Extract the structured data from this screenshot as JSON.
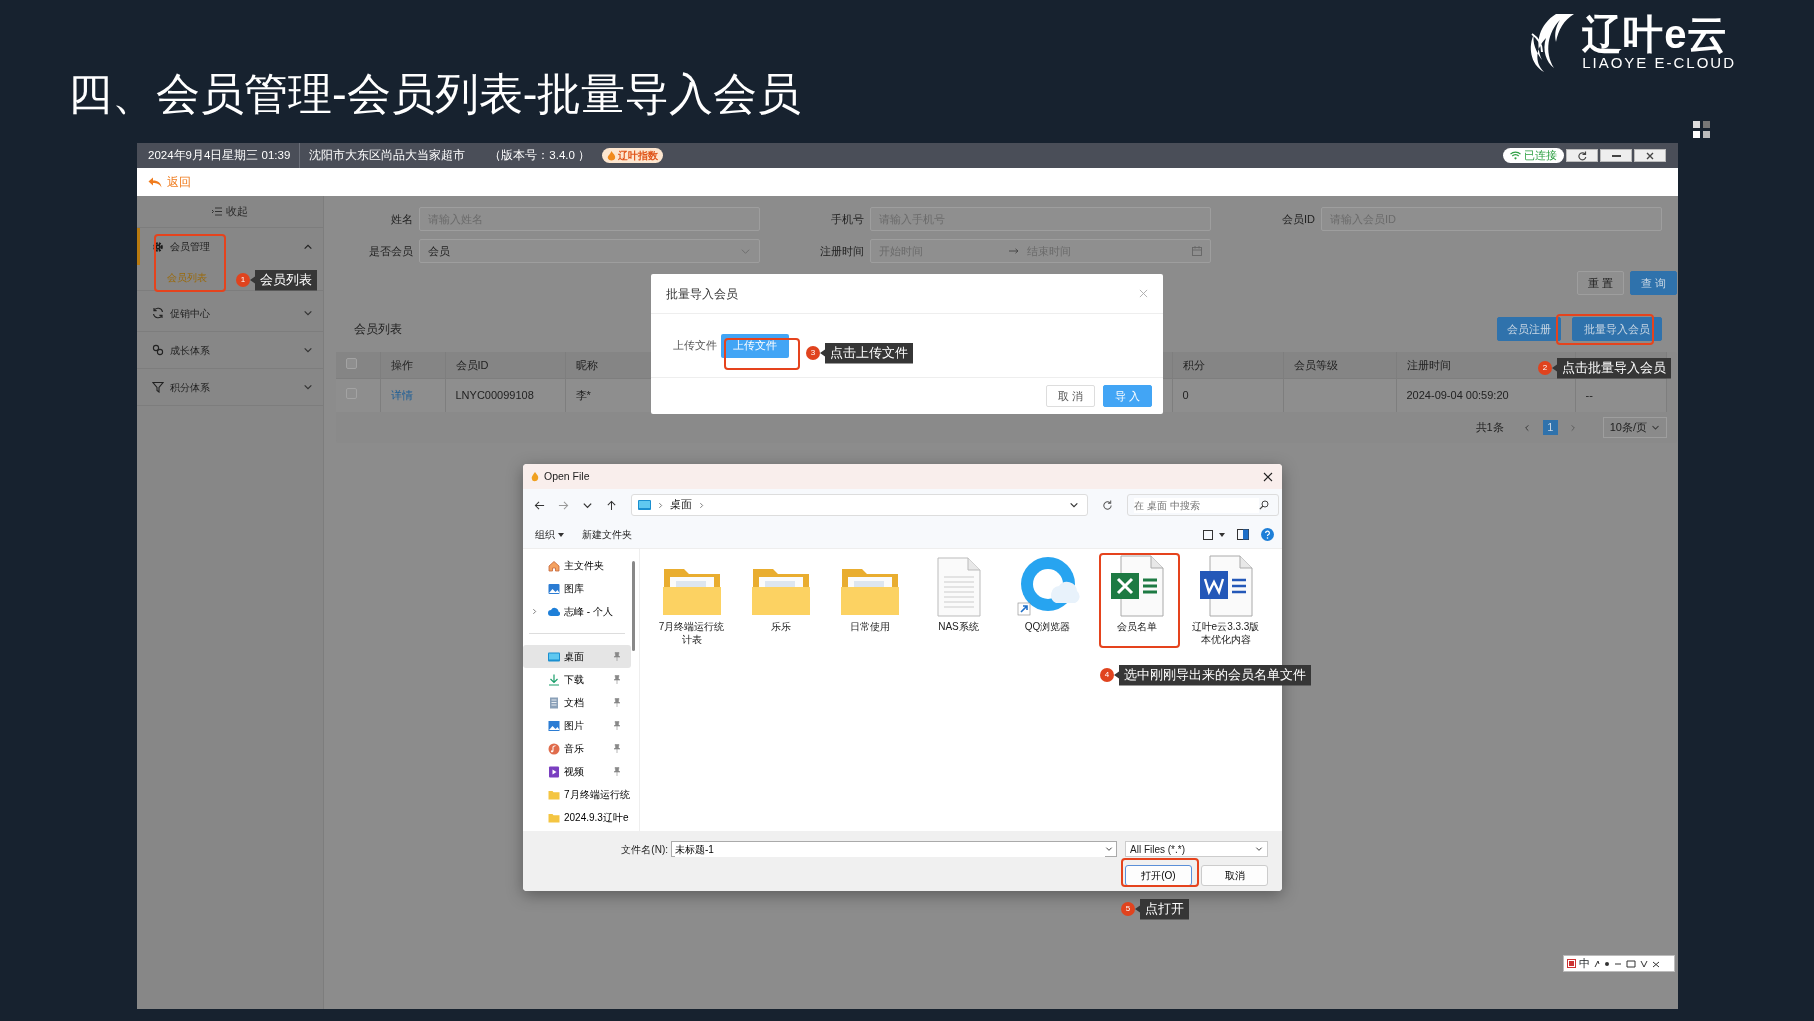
{
  "slide": {
    "title": "四、会员管理-会员列表-批量导入会员",
    "logo_name": "辽叶e云",
    "logo_tagline": "LIAOYE E-CLOUD"
  },
  "app": {
    "top_bar": {
      "datetime": "2024年9月4日星期三 01:39",
      "store": "沈阳市大东区尚品大当家超市",
      "version": "（版本号：3.4.0 ）",
      "badge": "辽叶指数",
      "connection": "已连接"
    },
    "back": "返回",
    "sidebar": {
      "collapse": "收起",
      "items": [
        {
          "label": "会员管理",
          "expanded": true,
          "children": [
            {
              "label": "会员列表",
              "selected": true
            }
          ]
        },
        {
          "label": "促销中心",
          "expanded": false
        },
        {
          "label": "成长体系",
          "expanded": false
        },
        {
          "label": "积分体系",
          "expanded": false
        }
      ]
    },
    "filters": [
      {
        "kind": "text",
        "label": "姓名",
        "placeholder": "请输入姓名"
      },
      {
        "kind": "text",
        "label": "手机号",
        "placeholder": "请输入手机号"
      },
      {
        "kind": "text",
        "label": "会员ID",
        "placeholder": "请输入会员ID"
      },
      {
        "kind": "select",
        "label": "是否会员",
        "value": "会员"
      },
      {
        "kind": "daterange",
        "label": "注册时间",
        "start_placeholder": "开始时间",
        "end_placeholder": "结束时间"
      }
    ],
    "filter_buttons": [
      {
        "label": "重 置",
        "primary": false
      },
      {
        "label": "查 询",
        "primary": true
      }
    ],
    "list_title": "会员列表",
    "list_buttons": [
      "会员注册",
      "批量导入会员"
    ],
    "table": {
      "header_checked": false,
      "columns": [
        "操作",
        "会员ID",
        "昵称",
        "积分",
        "会员等级",
        "注册时间"
      ],
      "rows": [
        {
          "checked": false,
          "action": "详情",
          "member_id": "LNYC00099108",
          "nickname": "李*",
          "points": "0",
          "register_time": "2024-09-04 00:59:20",
          "column_7": "--"
        }
      ]
    },
    "pagination": {
      "total": "共1条",
      "pages": [
        {
          "label": "1",
          "selected": true
        }
      ],
      "page_size": "10条/页"
    },
    "modal": {
      "title": "批量导入会员",
      "field_label": "上传文件",
      "upload_button": "上传文件",
      "buttons": [
        {
          "label": "取 消",
          "primary": false
        },
        {
          "label": "导 入",
          "primary": true
        }
      ]
    },
    "file_dialog": {
      "title": "Open File",
      "path": [
        "桌面"
      ],
      "search_placeholder": "在 桌面 中搜索",
      "toolbar": [
        "组织",
        "新建文件夹"
      ],
      "nav_groups": [
        [
          {
            "label": "主文件夹",
            "expandable": false,
            "pinned": false,
            "selected": false
          },
          {
            "label": "图库",
            "expandable": false,
            "pinned": false,
            "selected": false
          },
          {
            "label": "志峰 - 个人",
            "expandable": true,
            "pinned": false,
            "selected": false
          }
        ],
        [
          {
            "label": "桌面",
            "expandable": false,
            "pinned": true,
            "selected": true
          },
          {
            "label": "下载",
            "expandable": false,
            "pinned": true,
            "selected": false
          },
          {
            "label": "文档",
            "expandable": false,
            "pinned": true,
            "selected": false
          },
          {
            "label": "图片",
            "expandable": false,
            "pinned": true,
            "selected": false
          },
          {
            "label": "音乐",
            "expandable": false,
            "pinned": true,
            "selected": false
          },
          {
            "label": "视频",
            "expandable": false,
            "pinned": true,
            "selected": false
          },
          {
            "label": "7月终端运行统",
            "expandable": false,
            "pinned": false,
            "selected": false
          },
          {
            "label": "2024.9.3辽叶e",
            "expandable": false,
            "pinned": false,
            "selected": false
          }
        ]
      ],
      "files": [
        {
          "name": "7月终端运行统计表",
          "kind": "folder"
        },
        {
          "name": "乐乐",
          "kind": "folder"
        },
        {
          "name": "日常使用",
          "kind": "folder"
        },
        {
          "name": "NAS系统",
          "kind": "text"
        },
        {
          "name": "QQ浏览器",
          "kind": "shortcut"
        },
        {
          "name": "会员名单",
          "kind": "excel"
        },
        {
          "name": "辽叶e云3.3.3版本优化内容",
          "kind": "word"
        }
      ],
      "filename_label": "文件名(N):",
      "filename": "未标题-1",
      "filetype": "All Files (*.*)",
      "buttons": [
        "打开(O)",
        "取消"
      ]
    },
    "callouts": [
      {
        "number": "1",
        "text": "会员列表"
      },
      {
        "number": "2",
        "text": "点击批量导入会员"
      },
      {
        "number": "3",
        "text": "点击上传文件"
      },
      {
        "number": "4",
        "text": "选中刚刚导出来的会员名单文件"
      },
      {
        "number": "5",
        "text": "点打开"
      }
    ],
    "ime_bar": {
      "mode": "中"
    }
  }
}
